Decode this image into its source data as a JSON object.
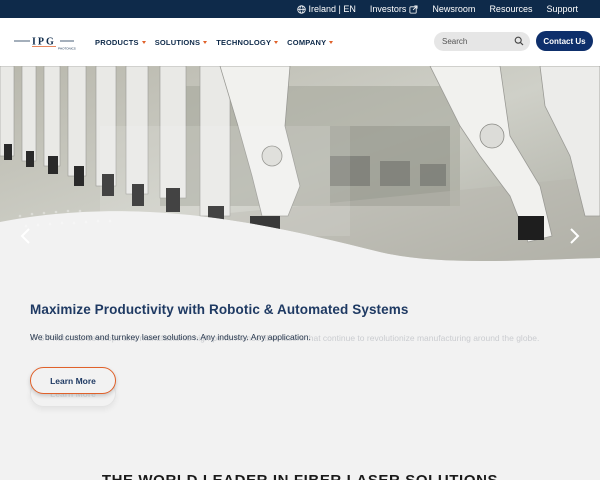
{
  "utility_bar": {
    "region_label": "Ireland | EN",
    "investors_label": "Investors",
    "newsroom_label": "Newsroom",
    "resources_label": "Resources",
    "support_label": "Support"
  },
  "brand": {
    "logo_text": "IPG PHOTONICS",
    "primary_color": "#0e2a4a",
    "accent_color": "#e0612a"
  },
  "nav": {
    "items": [
      {
        "label": "PRODUCTS"
      },
      {
        "label": "SOLUTIONS"
      },
      {
        "label": "TECHNOLOGY"
      },
      {
        "label": "COMPANY"
      }
    ],
    "search_placeholder": "Search",
    "contact_label": "Contact Us"
  },
  "hero": {
    "title": "Maximize Productivity with Robotic & Automated Systems",
    "subtitle": "We build custom and turnkey laser solutions. Any industry. Any application.",
    "ghost_subtitle": "IPG Photonics develops and manufactures high-performance fiber lasers that continue to revolutionize manufacturing around the globe.",
    "cta_label": "Learn More",
    "prev_icon": "chevron-left-icon",
    "next_icon": "chevron-right-icon"
  },
  "section": {
    "heading": "THE WORLD LEADER IN FIBER LASER SOLUTIONS"
  }
}
